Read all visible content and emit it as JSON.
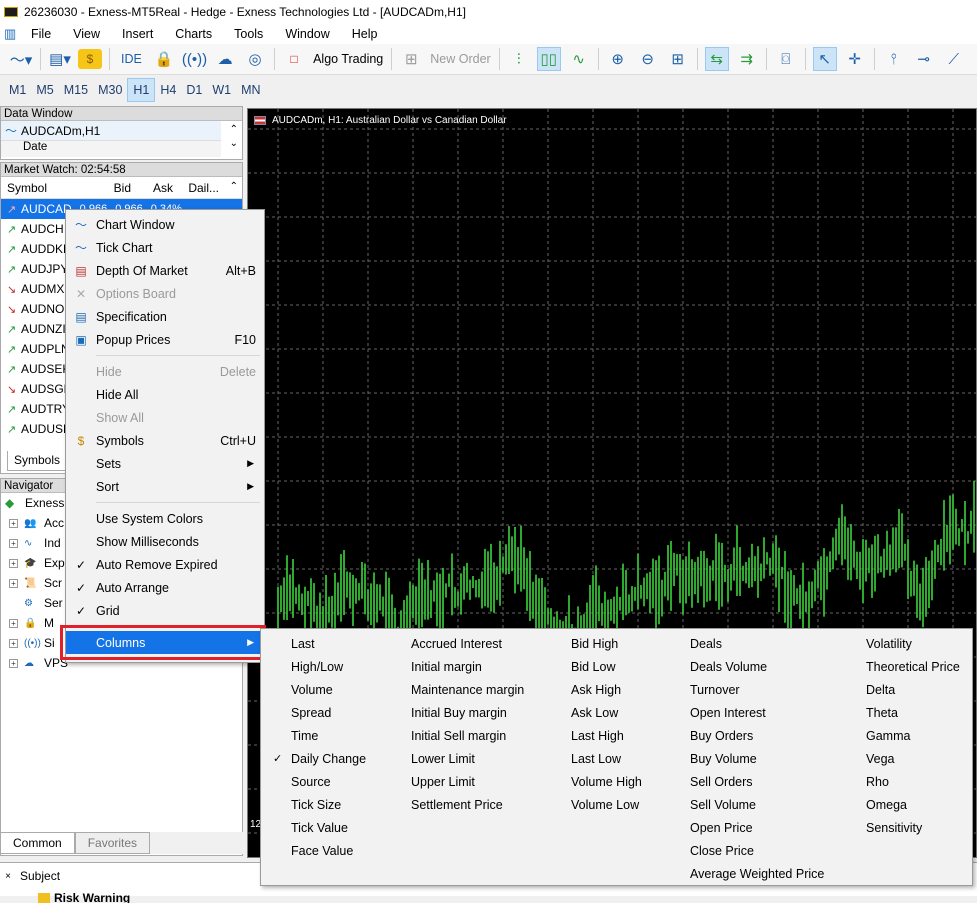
{
  "window": {
    "title": "26236030 - Exness-MT5Real - Hedge - Exness Technologies Ltd - [AUDCADm,H1]"
  },
  "menubar": [
    "File",
    "View",
    "Insert",
    "Charts",
    "Tools",
    "Window",
    "Help"
  ],
  "toolbar": {
    "ide": "IDE",
    "algo_trading": "Algo Trading",
    "new_order": "New Order"
  },
  "timeframes": [
    "M1",
    "M5",
    "M15",
    "M30",
    "H1",
    "H4",
    "D1",
    "W1",
    "MN"
  ],
  "selected_timeframe": "H1",
  "data_window": {
    "title": "Data Window",
    "symbol": "AUDCADm,H1",
    "date_label": "Date"
  },
  "market_watch": {
    "title": "Market Watch: 02:54:58",
    "columns": [
      "Symbol",
      "Bid",
      "Ask",
      "Dail..."
    ],
    "rows": [
      {
        "symbol": "AUDCAD",
        "dir": "up"
      },
      {
        "symbol": "AUDCH",
        "dir": "up"
      },
      {
        "symbol": "AUDDKK",
        "dir": "up"
      },
      {
        "symbol": "AUDJPY",
        "dir": "up"
      },
      {
        "symbol": "AUDMX",
        "dir": "down"
      },
      {
        "symbol": "AUDNO",
        "dir": "down"
      },
      {
        "symbol": "AUDNZI",
        "dir": "up"
      },
      {
        "symbol": "AUDPLN",
        "dir": "up"
      },
      {
        "symbol": "AUDSEK",
        "dir": "up"
      },
      {
        "symbol": "AUDSGD",
        "dir": "down"
      },
      {
        "symbol": "AUDTRY",
        "dir": "up"
      },
      {
        "symbol": "AUDUSD",
        "dir": "up"
      }
    ],
    "selected_values": {
      "bid": "0.966",
      "ask": "0.966",
      "daily": "0.34%"
    },
    "tab": "Symbols"
  },
  "navigator": {
    "title": "Navigator",
    "root": "Exness",
    "items": [
      "Acc",
      "Ind",
      "Exp",
      "Scr",
      "Ser",
      "M",
      "Si",
      "VPS"
    ]
  },
  "chart": {
    "label": "AUDCADm, H1:  Australian Dollar vs Canadian Dollar",
    "bottom_num": "12"
  },
  "bottom_tabs": [
    "Common",
    "Favorites"
  ],
  "subject": {
    "label": "Subject",
    "row": "Risk Warning"
  },
  "context_menu": [
    {
      "label": "Chart Window",
      "shortcut": "",
      "icon": "chart-window-icon",
      "enabled": true
    },
    {
      "label": "Tick Chart",
      "shortcut": "",
      "icon": "tick-chart-icon",
      "enabled": true
    },
    {
      "label": "Depth Of Market",
      "shortcut": "Alt+B",
      "icon": "depth-of-market-icon",
      "enabled": true
    },
    {
      "label": "Options Board",
      "shortcut": "",
      "icon": "options-board-icon",
      "enabled": false
    },
    {
      "label": "Specification",
      "shortcut": "",
      "icon": "specification-icon",
      "enabled": true
    },
    {
      "label": "Popup Prices",
      "shortcut": "F10",
      "icon": "popup-prices-icon",
      "enabled": true
    },
    {
      "sep": true
    },
    {
      "label": "Hide",
      "shortcut": "Delete",
      "enabled": false
    },
    {
      "label": "Hide All",
      "shortcut": "",
      "enabled": true
    },
    {
      "label": "Show All",
      "shortcut": "",
      "enabled": false
    },
    {
      "label": "Symbols",
      "shortcut": "Ctrl+U",
      "icon": "symbols-icon",
      "enabled": true
    },
    {
      "label": "Sets",
      "shortcut": "",
      "submenu": true,
      "enabled": true
    },
    {
      "label": "Sort",
      "shortcut": "",
      "submenu": true,
      "enabled": true
    },
    {
      "sep": true
    },
    {
      "label": "Use System Colors",
      "enabled": true
    },
    {
      "label": "Show Milliseconds",
      "enabled": true
    },
    {
      "label": "Auto Remove Expired",
      "checked": true,
      "enabled": true
    },
    {
      "label": "Auto Arrange",
      "checked": true,
      "enabled": true
    },
    {
      "label": "Grid",
      "checked": true,
      "enabled": true
    },
    {
      "sep": true
    },
    {
      "label": "Columns",
      "submenu": true,
      "highlighted": true,
      "enabled": true
    }
  ],
  "columns_submenu": [
    [
      {
        "label": "Last"
      },
      {
        "label": "High/Low"
      },
      {
        "label": "Volume"
      },
      {
        "label": "Spread"
      },
      {
        "label": "Time"
      },
      {
        "label": "Daily Change",
        "checked": true
      },
      {
        "label": "Source"
      },
      {
        "label": "Tick Size"
      },
      {
        "label": "Tick Value"
      },
      {
        "label": "Face Value"
      }
    ],
    [
      {
        "label": "Accrued Interest"
      },
      {
        "label": "Initial margin"
      },
      {
        "label": "Maintenance margin"
      },
      {
        "label": "Initial Buy margin"
      },
      {
        "label": "Initial Sell margin"
      },
      {
        "label": "Lower Limit"
      },
      {
        "label": "Upper Limit"
      },
      {
        "label": "Settlement Price"
      }
    ],
    [
      {
        "label": "Bid High"
      },
      {
        "label": "Bid Low"
      },
      {
        "label": "Ask High"
      },
      {
        "label": "Ask Low"
      },
      {
        "label": "Last High"
      },
      {
        "label": "Last Low"
      },
      {
        "label": "Volume High"
      },
      {
        "label": "Volume Low"
      }
    ],
    [
      {
        "label": "Deals"
      },
      {
        "label": "Deals Volume"
      },
      {
        "label": "Turnover"
      },
      {
        "label": "Open Interest"
      },
      {
        "label": "Buy Orders"
      },
      {
        "label": "Buy Volume"
      },
      {
        "label": "Sell Orders"
      },
      {
        "label": "Sell Volume"
      },
      {
        "label": "Open Price"
      },
      {
        "label": "Close Price"
      },
      {
        "label": "Average Weighted Price"
      }
    ],
    [
      {
        "label": "Volatility"
      },
      {
        "label": "Theoretical Price"
      },
      {
        "label": "Delta"
      },
      {
        "label": "Theta"
      },
      {
        "label": "Gamma"
      },
      {
        "label": "Vega"
      },
      {
        "label": "Rho"
      },
      {
        "label": "Omega"
      },
      {
        "label": "Sensitivity"
      }
    ]
  ]
}
